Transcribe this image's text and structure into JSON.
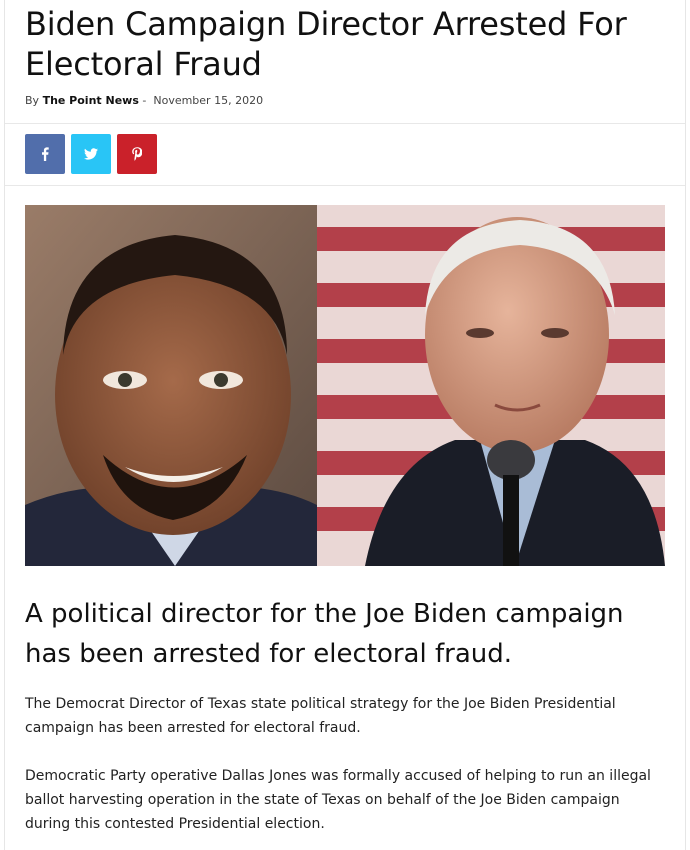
{
  "article": {
    "title": "Biden Campaign Director Arrested For Electoral Fraud",
    "byline_prefix": "By",
    "author": "The Point News",
    "separator": "-",
    "date": "November 15, 2020",
    "lede": "A political director for the Joe Biden campaign has been arrested for electoral fraud.",
    "paragraphs": [
      "The Democrat Director of Texas state political strategy for the Joe Biden Presidential campaign has been arrested for electoral fraud.",
      "Democratic Party operative Dallas Jones was formally accused of helping to run an illegal ballot harvesting operation in the state of Texas on behalf of the Joe Biden campaign during this contested Presidential election."
    ]
  },
  "share": {
    "buttons": [
      {
        "icon": "facebook-icon",
        "color": "#516eab"
      },
      {
        "icon": "twitter-icon",
        "color": "#29c5f6"
      },
      {
        "icon": "pinterest-icon",
        "color": "#ca212a"
      }
    ]
  },
  "colors": {
    "facebook": "#516eab",
    "twitter": "#29c5f6",
    "pinterest": "#ca212a"
  }
}
